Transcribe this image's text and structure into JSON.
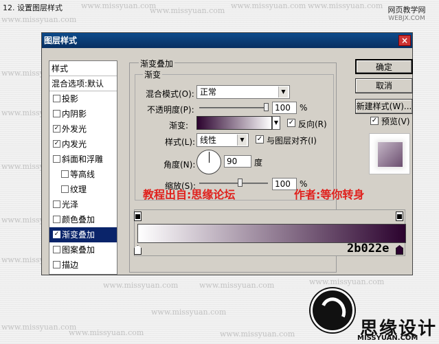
{
  "step_label": "12. 设置图层样式",
  "watermark": "www.missyuan.com",
  "site_badge": {
    "line1": "网页教学网",
    "line2": "WEBJX.COM"
  },
  "dialog": {
    "title": "图层样式"
  },
  "style_list": {
    "header": "样式",
    "blend_options": "混合选项:默认",
    "items": [
      {
        "label": "投影",
        "checked": false,
        "indent": false
      },
      {
        "label": "内阴影",
        "checked": false,
        "indent": false
      },
      {
        "label": "外发光",
        "checked": true,
        "indent": false
      },
      {
        "label": "内发光",
        "checked": true,
        "indent": false
      },
      {
        "label": "斜面和浮雕",
        "checked": false,
        "indent": false
      },
      {
        "label": "等高线",
        "checked": false,
        "indent": true
      },
      {
        "label": "纹理",
        "checked": false,
        "indent": true
      },
      {
        "label": "光泽",
        "checked": false,
        "indent": false
      },
      {
        "label": "颜色叠加",
        "checked": false,
        "indent": false
      },
      {
        "label": "渐变叠加",
        "checked": true,
        "indent": false,
        "selected": true
      },
      {
        "label": "图案叠加",
        "checked": false,
        "indent": false
      },
      {
        "label": "描边",
        "checked": false,
        "indent": false
      }
    ]
  },
  "panel": {
    "group_title": "渐变叠加",
    "inner_title": "渐变",
    "blend_mode": {
      "label": "混合模式(O):",
      "value": "正常"
    },
    "opacity": {
      "label": "不透明度(P):",
      "value": "100",
      "unit": "%",
      "level": 1.0
    },
    "gradient": {
      "label": "渐变:"
    },
    "reverse": {
      "label": "反向(R)",
      "checked": true
    },
    "style": {
      "label": "样式(L):",
      "value": "线性"
    },
    "align": {
      "label": "与图层对齐(I)",
      "checked": true
    },
    "angle": {
      "label": "角度(N):",
      "value": "90",
      "unit": "度"
    },
    "scale": {
      "label": "缩放(S):",
      "value": "100",
      "unit": "%"
    }
  },
  "buttons": {
    "ok": "确定",
    "cancel": "取消",
    "new_style": "新建样式(W)...",
    "preview": {
      "label": "预览(V)",
      "checked": true
    }
  },
  "gradient_editor": {
    "hex": "2b022e",
    "start_color": "#ffffff",
    "end_color": "#2b022e"
  },
  "credits": {
    "tutorial": "教程出自:思缘论坛",
    "author": "作者:等你转身"
  },
  "logo": {
    "text": "思缘设计",
    "sub": "MISSYUAN.COM"
  },
  "colors": {
    "titlebar": "#0d4b8a",
    "selected": "#0a246a",
    "credit": "#e0201c"
  }
}
